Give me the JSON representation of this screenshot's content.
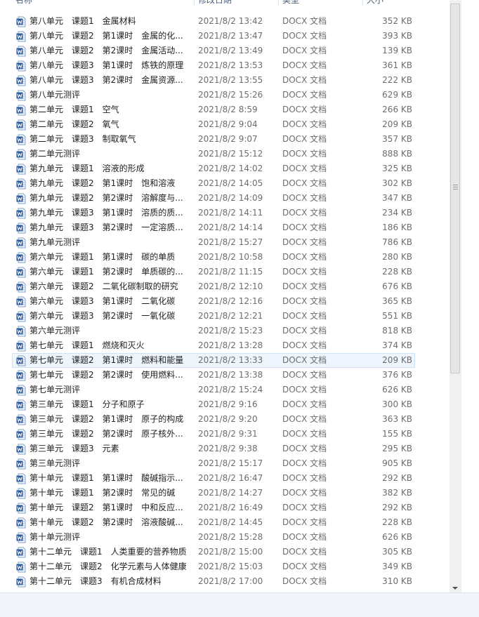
{
  "columns": {
    "name": "名称",
    "date": "修改日期",
    "type": "类型",
    "size": "大小"
  },
  "files": [
    {
      "name": "第八单元　课题1　金属材料",
      "date": "2021/8/2 13:42",
      "type": "DOCX 文档",
      "size": "352 KB"
    },
    {
      "name": "第八单元　课题2　第1课时　金属的化...",
      "date": "2021/8/2 13:47",
      "type": "DOCX 文档",
      "size": "393 KB"
    },
    {
      "name": "第八单元　课题2　第2课时　金属活动...",
      "date": "2021/8/2 13:49",
      "type": "DOCX 文档",
      "size": "139 KB"
    },
    {
      "name": "第八单元　课题3　第1课时　炼铁的原理",
      "date": "2021/8/2 13:53",
      "type": "DOCX 文档",
      "size": "361 KB"
    },
    {
      "name": "第八单元　课题3　第2课时　金属资源...",
      "date": "2021/8/2 13:55",
      "type": "DOCX 文档",
      "size": "222 KB"
    },
    {
      "name": "第八单元测评",
      "date": "2021/8/2 15:26",
      "type": "DOCX 文档",
      "size": "629 KB"
    },
    {
      "name": "第二单元　课题1　空气",
      "date": "2021/8/2 8:59",
      "type": "DOCX 文档",
      "size": "266 KB"
    },
    {
      "name": "第二单元　课题2　氧气",
      "date": "2021/8/2 9:04",
      "type": "DOCX 文档",
      "size": "209 KB"
    },
    {
      "name": "第二单元　课题3　制取氧气",
      "date": "2021/8/2 9:07",
      "type": "DOCX 文档",
      "size": "357 KB"
    },
    {
      "name": "第二单元测评",
      "date": "2021/8/2 15:12",
      "type": "DOCX 文档",
      "size": "888 KB"
    },
    {
      "name": "第九单元　课题1　溶液的形成",
      "date": "2021/8/2 14:02",
      "type": "DOCX 文档",
      "size": "325 KB"
    },
    {
      "name": "第九单元　课题2　第1课时　饱和溶液",
      "date": "2021/8/2 14:05",
      "type": "DOCX 文档",
      "size": "302 KB"
    },
    {
      "name": "第九单元　课题2　第2课时　溶解度与...",
      "date": "2021/8/2 14:09",
      "type": "DOCX 文档",
      "size": "347 KB"
    },
    {
      "name": "第九单元　课题3　第1课时　溶质的质...",
      "date": "2021/8/2 14:11",
      "type": "DOCX 文档",
      "size": "234 KB"
    },
    {
      "name": "第九单元　课题3　第2课时　一定溶质...",
      "date": "2021/8/2 14:14",
      "type": "DOCX 文档",
      "size": "186 KB"
    },
    {
      "name": "第九单元测评",
      "date": "2021/8/2 15:27",
      "type": "DOCX 文档",
      "size": "786 KB"
    },
    {
      "name": "第六单元　课题1　第1课时　碳的单质",
      "date": "2021/8/2 10:58",
      "type": "DOCX 文档",
      "size": "280 KB"
    },
    {
      "name": "第六单元　课题1　第2课时　单质碳的...",
      "date": "2021/8/2 11:15",
      "type": "DOCX 文档",
      "size": "228 KB"
    },
    {
      "name": "第六单元　课题2　二氧化碳制取的研究",
      "date": "2021/8/2 12:10",
      "type": "DOCX 文档",
      "size": "676 KB"
    },
    {
      "name": "第六单元　课题3　第1课时　二氧化碳",
      "date": "2021/8/2 12:16",
      "type": "DOCX 文档",
      "size": "365 KB"
    },
    {
      "name": "第六单元　课题3　第2课时　一氧化碳",
      "date": "2021/8/2 12:21",
      "type": "DOCX 文档",
      "size": "551 KB"
    },
    {
      "name": "第六单元测评",
      "date": "2021/8/2 15:23",
      "type": "DOCX 文档",
      "size": "818 KB"
    },
    {
      "name": "第七单元　课题1　燃烧和灭火",
      "date": "2021/8/2 13:28",
      "type": "DOCX 文档",
      "size": "374 KB"
    },
    {
      "name": "第七单元　课题2　第1课时　燃料和能量",
      "date": "2021/8/2 13:33",
      "type": "DOCX 文档",
      "size": "209 KB",
      "selected": true
    },
    {
      "name": "第七单元　课题2　第2课时　使用燃料...",
      "date": "2021/8/2 13:38",
      "type": "DOCX 文档",
      "size": "376 KB"
    },
    {
      "name": "第七单元测评",
      "date": "2021/8/2 15:24",
      "type": "DOCX 文档",
      "size": "626 KB"
    },
    {
      "name": "第三单元　课题1　分子和原子",
      "date": "2021/8/2 9:16",
      "type": "DOCX 文档",
      "size": "300 KB"
    },
    {
      "name": "第三单元　课题2　第1课时　原子的构成",
      "date": "2021/8/2 9:20",
      "type": "DOCX 文档",
      "size": "363 KB"
    },
    {
      "name": "第三单元　课题2　第2课时　原子核外...",
      "date": "2021/8/2 9:31",
      "type": "DOCX 文档",
      "size": "155 KB"
    },
    {
      "name": "第三单元　课题3　元素",
      "date": "2021/8/2 9:38",
      "type": "DOCX 文档",
      "size": "295 KB"
    },
    {
      "name": "第三单元测评",
      "date": "2021/8/2 15:17",
      "type": "DOCX 文档",
      "size": "905 KB"
    },
    {
      "name": "第十单元　课题1　第1课时　酸碱指示...",
      "date": "2021/8/2 16:47",
      "type": "DOCX 文档",
      "size": "292 KB"
    },
    {
      "name": "第十单元　课题1　第2课时　常见的碱",
      "date": "2021/8/2 14:27",
      "type": "DOCX 文档",
      "size": "382 KB"
    },
    {
      "name": "第十单元　课题2　第1课时　中和反应...",
      "date": "2021/8/2 16:49",
      "type": "DOCX 文档",
      "size": "292 KB"
    },
    {
      "name": "第十单元　课题2　第2课时　溶液酸碱...",
      "date": "2021/8/2 14:45",
      "type": "DOCX 文档",
      "size": "228 KB"
    },
    {
      "name": "第十单元测评",
      "date": "2021/8/2 15:28",
      "type": "DOCX 文档",
      "size": "626 KB"
    },
    {
      "name": "第十二单元　课题1　人类重要的营养物质",
      "date": "2021/8/2 15:00",
      "type": "DOCX 文档",
      "size": "305 KB"
    },
    {
      "name": "第十二单元　课题2　化学元素与人体健康",
      "date": "2021/8/2 15:03",
      "type": "DOCX 文档",
      "size": "349 KB"
    },
    {
      "name": "第十二单元　课题3　有机合成材料",
      "date": "2021/8/2 17:00",
      "type": "DOCX 文档",
      "size": "310 KB"
    }
  ],
  "icons": {
    "file": "word-docx-icon"
  },
  "colors": {
    "word_blue": "#2b579a",
    "selection": "#eef5fd"
  }
}
